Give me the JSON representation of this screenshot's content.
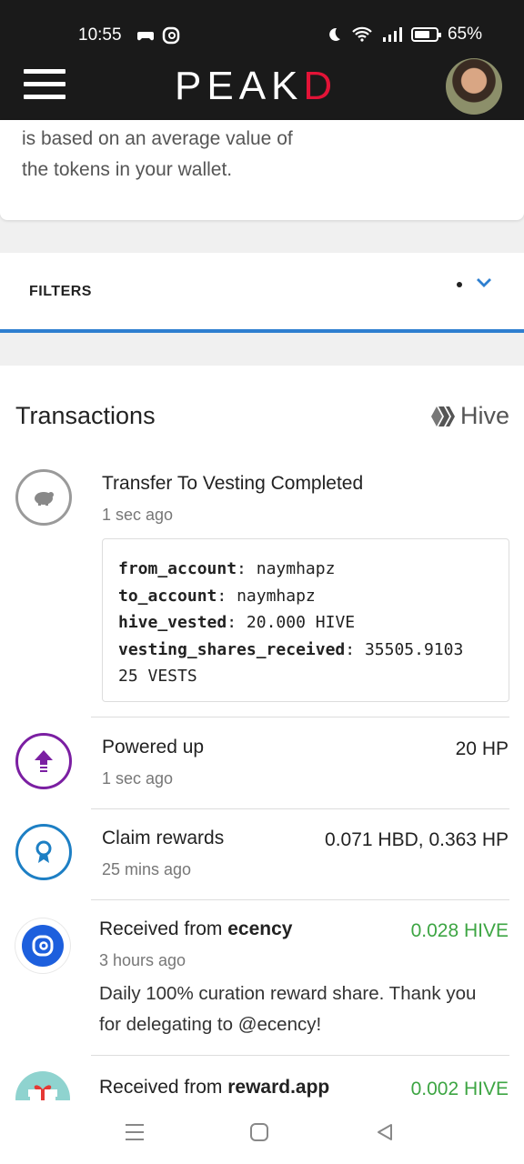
{
  "status_bar": {
    "time": "10:55",
    "battery": "65%"
  },
  "header": {
    "logo_main": "PEAK",
    "logo_accent": "D"
  },
  "info_card": {
    "line1": "is based on an average value of",
    "line2": "the tokens in your wallet."
  },
  "filters": {
    "label": "FILTERS"
  },
  "transactions": {
    "title": "Transactions",
    "chain_label": "Hive",
    "items": [
      {
        "title": "Transfer To Vesting Completed",
        "time": "1 sec ago",
        "details": [
          {
            "key": "from_account",
            "value": "naymhapz"
          },
          {
            "key": "to_account",
            "value": "naymhapz"
          },
          {
            "key": "hive_vested",
            "value": "20.000 HIVE"
          },
          {
            "key": "vesting_shares_received",
            "value": "35505.9103"
          },
          {
            "key": "",
            "value": "25 VESTS"
          }
        ]
      },
      {
        "title": "Powered up",
        "time": "1 sec ago",
        "amount": "20 HP"
      },
      {
        "title": "Claim rewards",
        "time": "25 mins ago",
        "amount": "0.071 HBD, 0.363 HP"
      },
      {
        "title_prefix": "Received from ",
        "title_account": "ecency",
        "time": "3 hours ago",
        "amount": "0.028 HIVE",
        "memo_line1": "Daily 100% curation reward share. Thank you",
        "memo_line2": "for delegating to @ecency!"
      },
      {
        "title_prefix": "Received from ",
        "title_account": "reward.app",
        "amount": "0.002 HIVE"
      }
    ]
  },
  "colors": {
    "brand_red": "#e31337",
    "accent_blue": "#2e7fd0",
    "power_up_purple": "#7b1fa2",
    "claim_blue": "#1d7fc4",
    "received_green": "#3da543"
  }
}
